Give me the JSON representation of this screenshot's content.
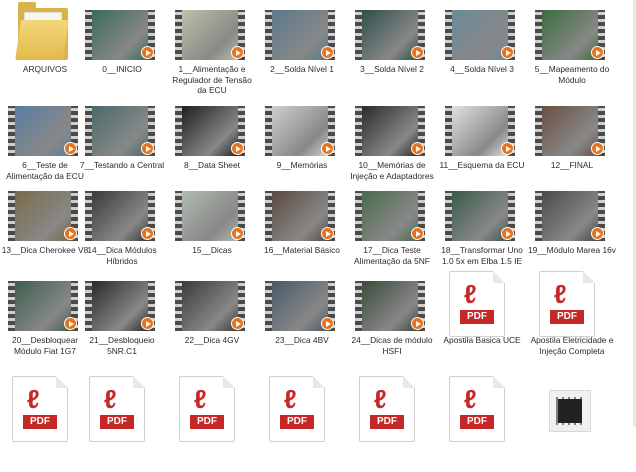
{
  "explorer": {
    "items": [
      {
        "label": "ARQUIVOS",
        "type": "folder"
      },
      {
        "label": "0__INICIO",
        "type": "video",
        "tone": "#3a6a5a"
      },
      {
        "label": "1__Alimentação e Regulador de Tensão da ECU",
        "type": "video",
        "tone": "#bfbfa8"
      },
      {
        "label": "2__Solda Nível 1",
        "type": "video",
        "tone": "#5a7a8a"
      },
      {
        "label": "3__Solda Nível 2",
        "type": "video",
        "tone": "#2e4f4a"
      },
      {
        "label": "4__Solda Nível 3",
        "type": "video",
        "tone": "#6a8a9a"
      },
      {
        "label": "5__Mapeamento do Módulo",
        "type": "video",
        "tone": "#3c6c3c"
      },
      {
        "label": "6__Teste de Alimentação da ECU",
        "type": "video",
        "tone": "#5a7ea0"
      },
      {
        "label": "7__Testando a Central",
        "type": "video",
        "tone": "#4a6a6a"
      },
      {
        "label": "8__Data Sheet",
        "type": "video",
        "tone": "#1f1f1f"
      },
      {
        "label": "9__Memórias",
        "type": "video",
        "tone": "#cfcfcf"
      },
      {
        "label": "10__Memórias de Injeção e Adaptadores",
        "type": "video",
        "tone": "#2a2a2a"
      },
      {
        "label": "11__Esquema da ECU",
        "type": "video",
        "tone": "#e0e0e0"
      },
      {
        "label": "12__FINAL",
        "type": "video",
        "tone": "#6a5040"
      },
      {
        "label": "13__Dica Cherokee V8",
        "type": "video",
        "tone": "#7a6a4a"
      },
      {
        "label": "14__Dica Módulos Híbridos",
        "type": "video",
        "tone": "#3a3a3a"
      },
      {
        "label": "15__Dicas",
        "type": "video",
        "tone": "#b0bab0"
      },
      {
        "label": "16__Material Básico",
        "type": "video",
        "tone": "#5a4a40"
      },
      {
        "label": "17__Dica Teste Alimentação da 5NF",
        "type": "video",
        "tone": "#4a6a4a"
      },
      {
        "label": "18__Transformar Uno 1.0 5x em Elba 1.5 IE",
        "type": "video",
        "tone": "#3a5a4a"
      },
      {
        "label": "19__Módulo Marea 16v",
        "type": "video",
        "tone": "#4a4a4a"
      },
      {
        "label": "20__Desbloquear Módulo Fiat 1G7",
        "type": "video",
        "tone": "#3e5e4e"
      },
      {
        "label": "21__Desbloqueio 5NR.C1",
        "type": "video",
        "tone": "#2a2a2a"
      },
      {
        "label": "22__Dica 4GV",
        "type": "video",
        "tone": "#3a3a3a"
      },
      {
        "label": "23__Dica 4BV",
        "type": "video",
        "tone": "#4a5a6a"
      },
      {
        "label": "24__Dicas de módulo HSFI",
        "type": "video",
        "tone": "#3a4a3a"
      },
      {
        "label": "Apostila Basica UCE",
        "type": "pdf",
        "badge": "PDF"
      },
      {
        "label": "Apostila Eletricidade e Injeção Completa",
        "type": "pdf",
        "badge": "PDF"
      },
      {
        "label": "",
        "type": "pdf",
        "badge": "PDF"
      },
      {
        "label": "",
        "type": "pdf",
        "badge": "PDF"
      },
      {
        "label": "",
        "type": "pdf",
        "badge": "PDF"
      },
      {
        "label": "",
        "type": "pdf",
        "badge": "PDF"
      },
      {
        "label": "",
        "type": "pdf",
        "badge": "PDF"
      },
      {
        "label": "",
        "type": "pdf",
        "badge": "PDF"
      },
      {
        "label": "",
        "type": "chip"
      }
    ]
  }
}
